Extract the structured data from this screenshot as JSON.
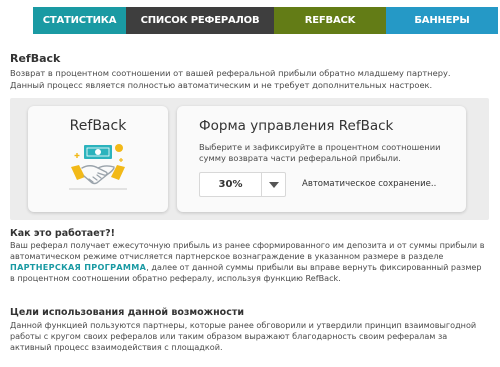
{
  "tabs": [
    {
      "label": "СТАТИСТИКА",
      "color": "#1a9aa3"
    },
    {
      "label": "СПИСОК РЕФЕРАЛОВ",
      "color": "#3e3e3e"
    },
    {
      "label": "REFBACK",
      "color": "#637c16",
      "active": true
    },
    {
      "label": "БАННЕРЫ",
      "color": "#2599c6"
    }
  ],
  "section": {
    "title": "RefBack",
    "intro": "Возврат в процентном соотношении от вашей реферальной прибыли обратно младшему партнеру. Данный процесс является полностью автоматическим и не требует дополнительных настроек."
  },
  "card_left": {
    "title": "RefBack",
    "illustration_icon": "handshake-money-icon"
  },
  "form": {
    "title": "Форма управления RefBack",
    "description": "Выберите и зафиксируйте в процентном соотношении сумму возврата части реферальной прибыли.",
    "select_value": "30%",
    "autosave_text": "Автоматическое сохранение.."
  },
  "how": {
    "title": "Как это работает?!",
    "text_before": "Ваш реферал получает ежесуточную прибыль из ранее сформированного им депозита и от суммы прибыли в автоматическом режиме отчисляется партнерское вознаграждение в указанном размере в разделе ",
    "link": "ПАРТНЕРСКАЯ ПРОГРАММА",
    "text_after": ", далее от данной суммы прибыли вы вправе вернуть фиксированный размер в процентном соотношении обратно рефералу, используя функцию RefBack."
  },
  "goals": {
    "title": "Цели использования данной возможности",
    "text": "Данной функцией пользуются партнеры, которые ранее обговорили и утвердили принцип взаимовыгодной работы с кругом своих рефералов или таким образом выражают благодарность своим рефералам за активный процесс взаимодействия с площадкой."
  },
  "colors": {
    "accent": "#1a9aa3",
    "panel_bg": "#ececec",
    "coin": "#f2b918",
    "banknote": "#2bb3bd"
  }
}
